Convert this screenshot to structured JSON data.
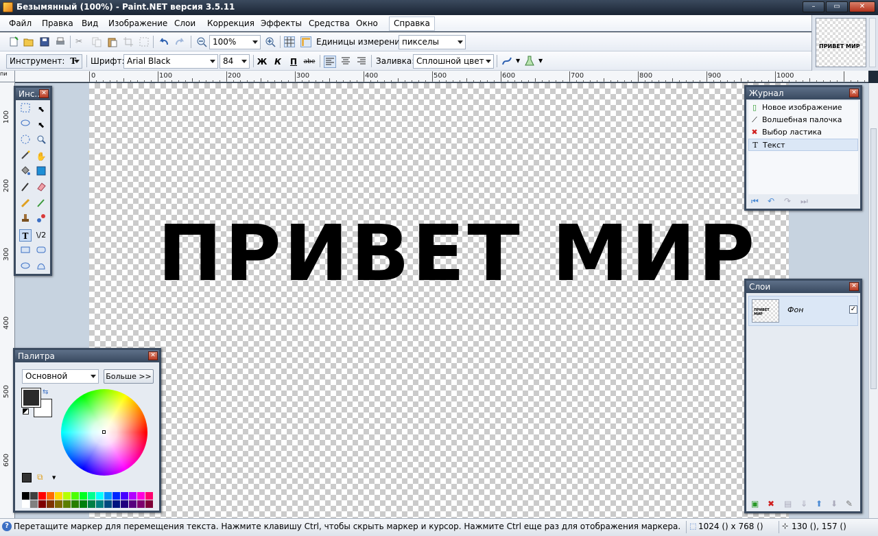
{
  "window": {
    "title": "Безымянный (100%) - Paint.NET версия 3.5.11"
  },
  "menu": [
    "Файл",
    "Правка",
    "Вид",
    "Изображение",
    "Слои",
    "Коррекция",
    "Эффекты",
    "Средства",
    "Окно",
    "Справка"
  ],
  "toolbar1": {
    "zoom": "100%",
    "units_label": "Единицы измерения:",
    "units_value": "пикселы"
  },
  "toolbar2": {
    "tool_label": "Инструмент:",
    "font_label": "Шрифт:",
    "font_value": "Arial Black",
    "size_value": "84",
    "bold": "Ж",
    "italic": "К",
    "underline": "П",
    "strike": "abe",
    "fill_label": "Заливка:",
    "fill_value": "Сплошной цвет"
  },
  "ruler": {
    "corner": "пи",
    "top_labels": [
      "0",
      "100",
      "200",
      "300",
      "400",
      "500",
      "600",
      "700",
      "800",
      "900",
      "1000",
      "1100"
    ],
    "left_labels": [
      "100",
      "200",
      "300",
      "400",
      "500",
      "600"
    ]
  },
  "canvas": {
    "text": "ПРИВЕТ МИР"
  },
  "thumbnail": {
    "text": "ПРИВЕТ МИР"
  },
  "tools_panel": {
    "title": "Инс..."
  },
  "history_panel": {
    "title": "Журнал",
    "items": [
      {
        "label": "Новое изображение",
        "icon": "new-image-icon"
      },
      {
        "label": "Волшебная палочка",
        "icon": "magic-wand-icon"
      },
      {
        "label": "Выбор ластика",
        "icon": "eraser-selection-icon"
      },
      {
        "label": "Текст",
        "icon": "text-icon"
      }
    ]
  },
  "layers_panel": {
    "title": "Слои",
    "layer_name": "Фон",
    "thumb_text": "ПРИВЕТ МИР"
  },
  "palette_panel": {
    "title": "Палитра",
    "mode": "Основной",
    "more_button": "Больше >>"
  },
  "status": {
    "message": "Перетащите маркер для перемещения текста. Нажмите клавишу Ctrl, чтобы скрыть маркер и курсор. Нажмите Ctrl еще раз для отображения маркера.",
    "image_size": "1024 () x 768 ()",
    "cursor_pos": "130 (), 157 ()"
  },
  "colors": {
    "accent": "#3b4b60",
    "canvas_text": "#000000",
    "primary_color": "#2b2b2b",
    "secondary_color": "#ffffff"
  }
}
